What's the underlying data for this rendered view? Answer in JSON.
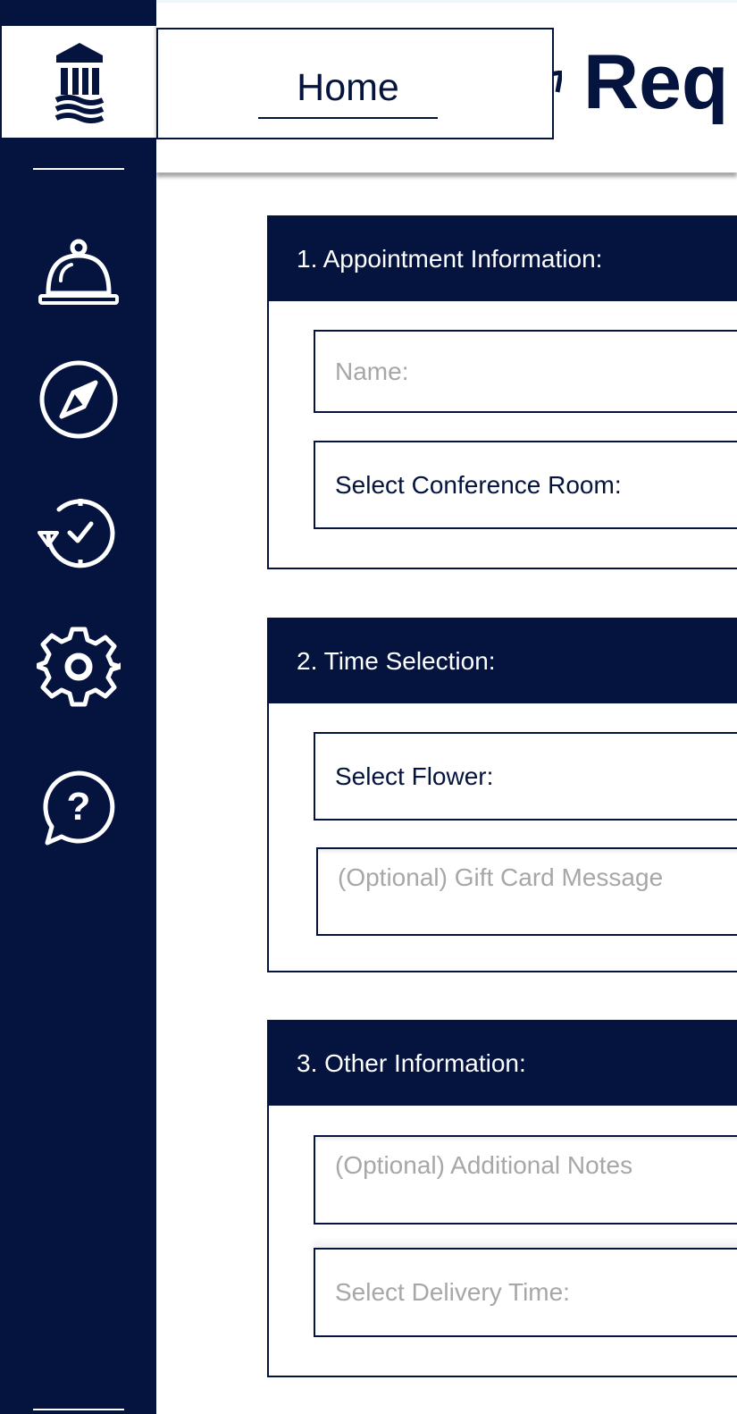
{
  "header": {
    "home_tab": "Home",
    "title_visible": "Req"
  },
  "sidebar": {
    "icons": [
      "institution-logo-icon",
      "service-bell-icon",
      "compass-icon",
      "history-check-icon",
      "settings-gear-icon",
      "help-question-icon"
    ]
  },
  "sections": [
    {
      "title": "1. Appointment Information:",
      "fields": [
        {
          "kind": "text-input",
          "placeholder": "Name:"
        },
        {
          "kind": "select",
          "label": "Select Conference Room:"
        }
      ]
    },
    {
      "title": "2. Time Selection:",
      "fields": [
        {
          "kind": "select",
          "label": "Select Flower:"
        },
        {
          "kind": "textarea",
          "placeholder": "(Optional) Gift Card Message"
        }
      ]
    },
    {
      "title": "3. Other Information:",
      "fields": [
        {
          "kind": "textarea",
          "placeholder": "(Optional) Additional Notes"
        },
        {
          "kind": "select",
          "placeholder": "Select Delivery Time:"
        }
      ]
    }
  ],
  "colors": {
    "navy": "#04143f",
    "placeholder_gray": "#a7a7a7",
    "white": "#ffffff"
  }
}
